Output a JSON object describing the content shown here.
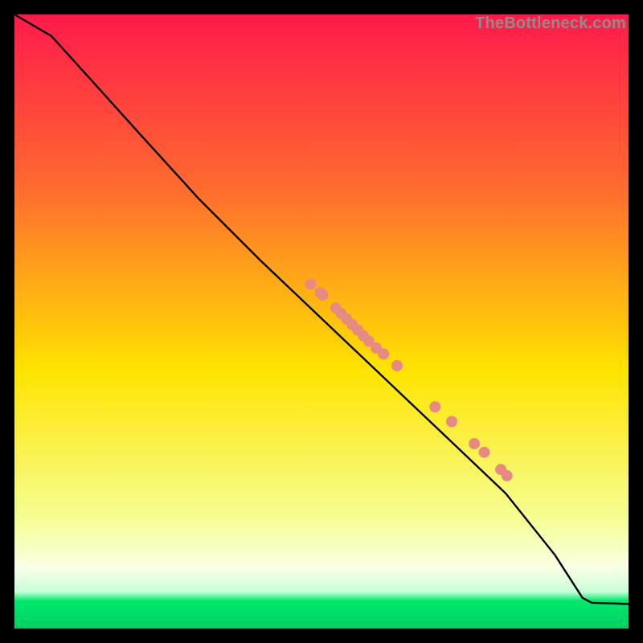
{
  "watermark": "TheBottleneck.com",
  "colors": {
    "gradient_top": "#ff1a4b",
    "gradient_upper_mid": "#ff6a2f",
    "gradient_mid": "#ffe400",
    "gradient_lower_mid": "#f6ff9a",
    "gradient_pale": "#faffe5",
    "gradient_green_band": "#00e86b",
    "gradient_bottom_green": "#00d060",
    "line_color": "#000000",
    "point_fill": "#e78b82",
    "point_stroke": "#cf584e",
    "frame_bg": "#000000"
  },
  "chart_data": {
    "type": "line",
    "title": "",
    "xlabel": "",
    "ylabel": "",
    "xlim": [
      0,
      100
    ],
    "ylim": [
      0,
      100
    ],
    "curve": [
      {
        "x": 0,
        "y": 100
      },
      {
        "x": 6,
        "y": 96.5
      },
      {
        "x": 11,
        "y": 91
      },
      {
        "x": 20,
        "y": 81
      },
      {
        "x": 30,
        "y": 70
      },
      {
        "x": 40,
        "y": 60
      },
      {
        "x": 50,
        "y": 50.5
      },
      {
        "x": 60,
        "y": 41
      },
      {
        "x": 70,
        "y": 31.5
      },
      {
        "x": 80,
        "y": 22
      },
      {
        "x": 88,
        "y": 12
      },
      {
        "x": 92.5,
        "y": 5
      },
      {
        "x": 94,
        "y": 4.2
      },
      {
        "x": 100,
        "y": 4
      }
    ],
    "points": [
      {
        "x": 48.2,
        "y": 56.1
      },
      {
        "x": 49.8,
        "y": 54.7
      },
      {
        "x": 50.2,
        "y": 54.3
      },
      {
        "x": 52.3,
        "y": 52.2
      },
      {
        "x": 53.2,
        "y": 51.3
      },
      {
        "x": 54.1,
        "y": 50.4
      },
      {
        "x": 55.0,
        "y": 49.5
      },
      {
        "x": 55.9,
        "y": 48.6
      },
      {
        "x": 56.8,
        "y": 47.7
      },
      {
        "x": 57.7,
        "y": 46.8
      },
      {
        "x": 58.9,
        "y": 45.7
      },
      {
        "x": 60.1,
        "y": 44.7
      },
      {
        "x": 62.3,
        "y": 42.8
      },
      {
        "x": 68.5,
        "y": 36.1
      },
      {
        "x": 71.2,
        "y": 33.7
      },
      {
        "x": 74.9,
        "y": 30.1
      },
      {
        "x": 76.5,
        "y": 28.7
      },
      {
        "x": 79.2,
        "y": 25.9
      },
      {
        "x": 80.2,
        "y": 24.9
      }
    ]
  }
}
